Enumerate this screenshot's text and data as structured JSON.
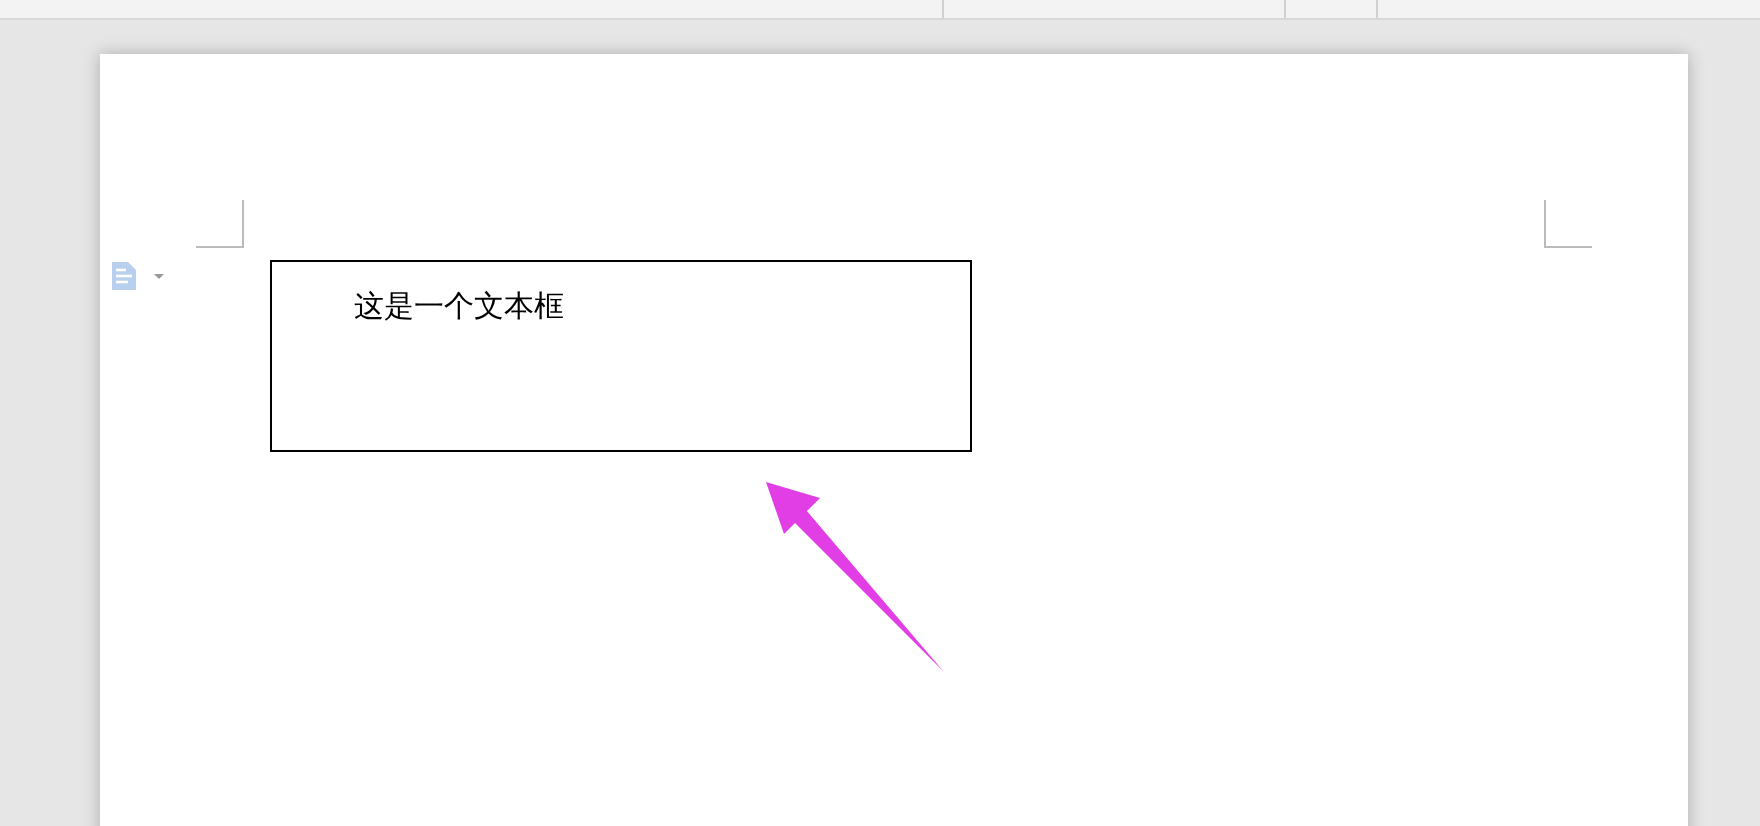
{
  "document": {
    "text_box": {
      "text": "这是一个文本框"
    }
  }
}
